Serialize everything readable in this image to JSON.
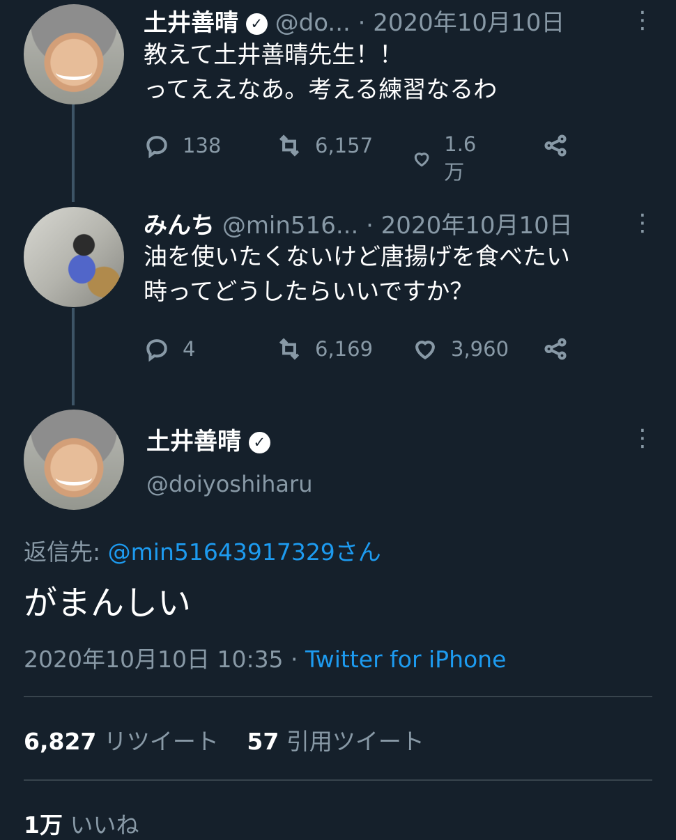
{
  "tweets": [
    {
      "name": "土井善晴",
      "verified_icon": "verified-badge-icon",
      "handle": "@do...",
      "date": "· 2020年10月10日",
      "lines": [
        "教えて土井善晴先生！！",
        "ってええなあ。考える練習なるわ"
      ],
      "replies": "138",
      "retweets": "6,157",
      "likes": "1.6万"
    },
    {
      "name": "みんち",
      "handle": "@min516...",
      "date": "· 2020年10月10日",
      "lines": [
        "油を使いたくないけど唐揚げを食べたい",
        "時ってどうしたらいいですか？"
      ],
      "replies": "4",
      "retweets": "6,169",
      "likes": "3,960"
    }
  ],
  "main": {
    "name": "土井善晴",
    "handle": "@doiyoshiharu",
    "reply_prefix": "返信先:",
    "reply_to": "@min51643917329さん",
    "text": "がまんしい",
    "timestamp": "2020年10月10日 10:35 ·",
    "source": "Twitter for iPhone",
    "retweet_count": "6,827",
    "retweet_label": "リツイート",
    "quote_count": "57",
    "quote_label": "引用ツイート",
    "like_count": "1万",
    "like_label": "いいね"
  },
  "colors": {
    "background": "#15202b",
    "muted": "#8899a6",
    "link": "#1d9bf0",
    "divider": "#38444d"
  }
}
